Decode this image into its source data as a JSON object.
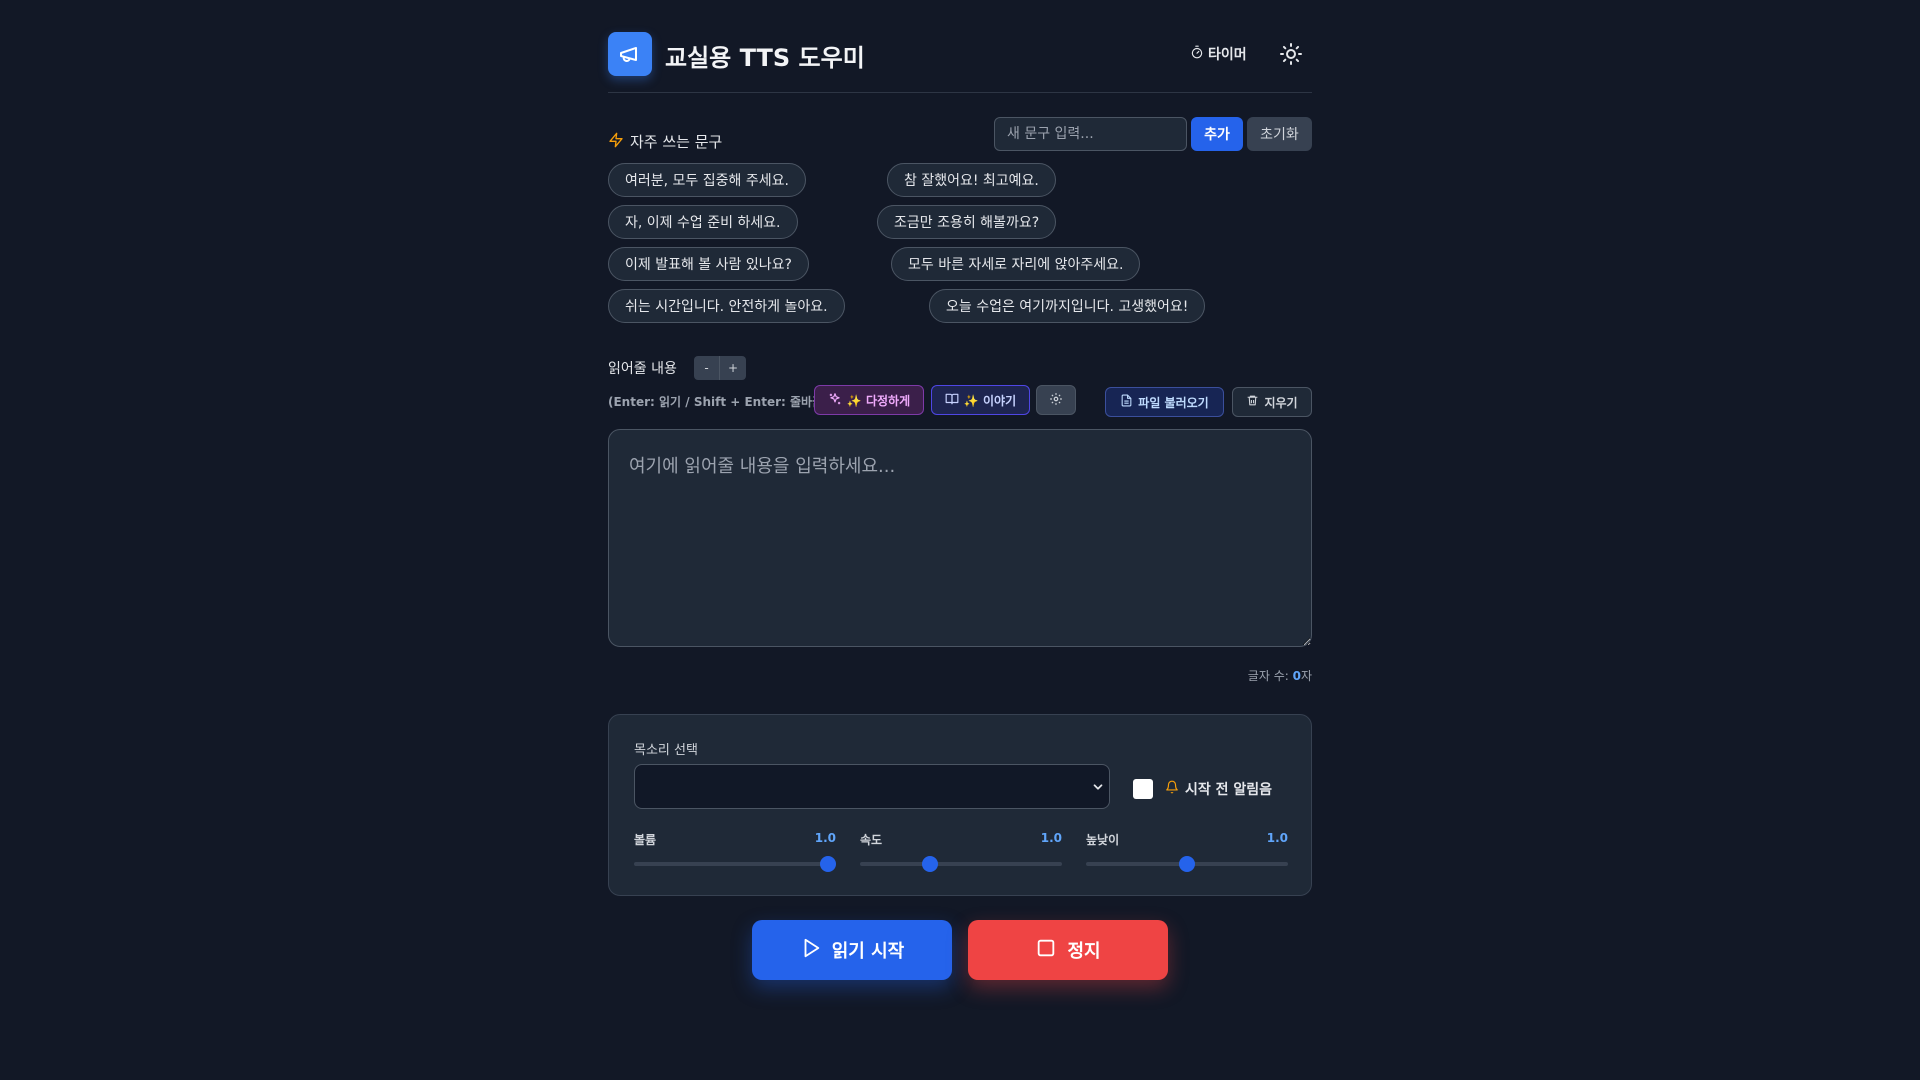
{
  "app": {
    "title": "교실용 TTS 도우미"
  },
  "header": {
    "timer_label": "타이머"
  },
  "phrases": {
    "title": "자주 쓰는 문구",
    "input_placeholder": "새 문구 입력...",
    "add_label": "추가",
    "reset_label": "초기화",
    "items": [
      "여러분, 모두 집중해 주세요.",
      "참 잘했어요! 최고예요.",
      "자, 이제 수업 준비 하세요.",
      "조금만 조용히 해볼까요?",
      "이제 발표해 볼 사람 있나요?",
      "모두 바른 자세로 자리에 앉아주세요.",
      "쉬는 시간입니다. 안전하게 놀아요.",
      "오늘 수업은 여기까지입니다. 고생했어요!"
    ]
  },
  "reader": {
    "label": "읽어줄 내용",
    "font_minus": "-",
    "font_plus": "+",
    "hint": "(Enter: 읽기 / Shift + Enter: 줄바꿈)",
    "kind_label": "✨ 다정하게",
    "story_label": "✨ 이야기",
    "file_label": "파일 불러오기",
    "clear_label": "지우기",
    "text_placeholder": "여기에 읽어줄 내용을 입력하세요...",
    "text_value": "",
    "char_count_prefix": "글자 수: ",
    "char_count_value": "0",
    "char_count_suffix": "자"
  },
  "settings": {
    "voice_label": "목소리 선택",
    "voice_value": "",
    "chime_label": "시작 전 알림음",
    "chime_checked": false,
    "sliders": [
      {
        "name": "볼륨",
        "value": "1.0",
        "fraction": 0.96
      },
      {
        "name": "속도",
        "value": "1.0",
        "fraction": 0.345
      },
      {
        "name": "높낮이",
        "value": "1.0",
        "fraction": 0.5
      }
    ]
  },
  "actions": {
    "start_label": "읽기 시작",
    "stop_label": "정지"
  },
  "colors": {
    "background": "#121826",
    "accent": "#2563eb",
    "danger": "#ef4444",
    "panel": "#1f2937"
  }
}
